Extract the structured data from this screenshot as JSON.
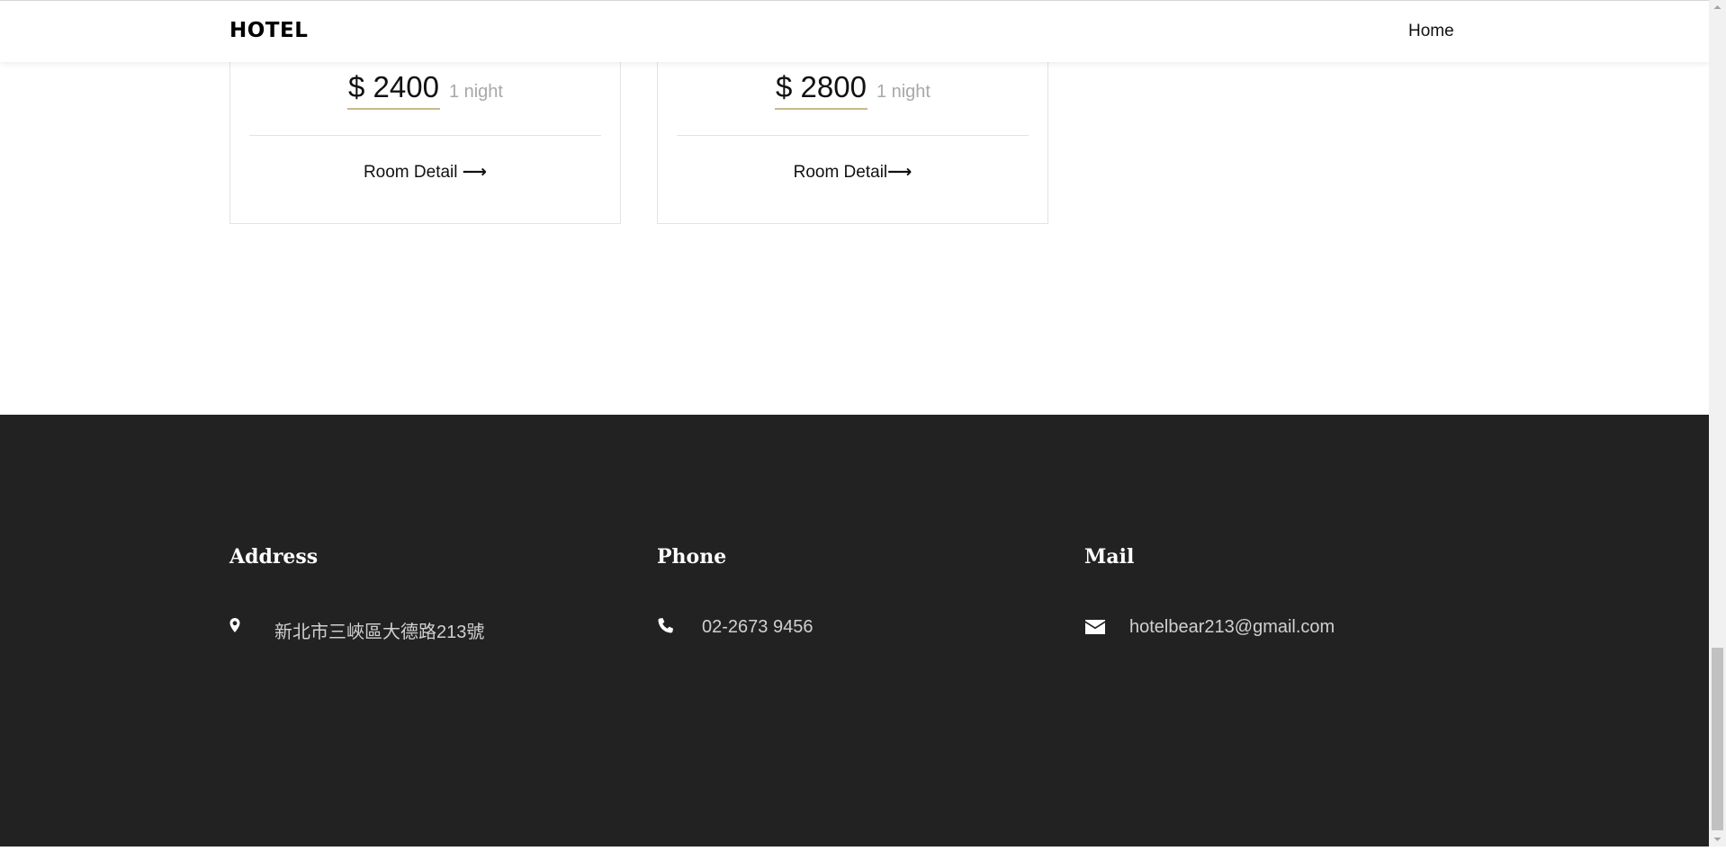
{
  "navbar": {
    "brand": "HOTEL",
    "links": [
      {
        "label": "Home"
      }
    ]
  },
  "rooms": [
    {
      "price": "$ 2400",
      "per": "1 night",
      "detail_label": "Room Detail "
    },
    {
      "price": "$ 2800",
      "per": "1 night",
      "detail_label": "Room Detail"
    }
  ],
  "footer": {
    "address": {
      "title": "Address",
      "value": "新北市三峽區大德路213號",
      "icon": "map-marker-icon"
    },
    "phone": {
      "title": "Phone",
      "value": "02-2673 9456",
      "icon": "phone-icon"
    },
    "mail": {
      "title": "Mail",
      "value": "hotelbear213@gmail.com",
      "icon": "envelope-icon"
    }
  },
  "colors": {
    "accent_underline": "#c9b88a",
    "footer_bg": "#222222",
    "muted_text": "#a8a8a8"
  },
  "scroll": {
    "position_fraction": 1.0
  }
}
